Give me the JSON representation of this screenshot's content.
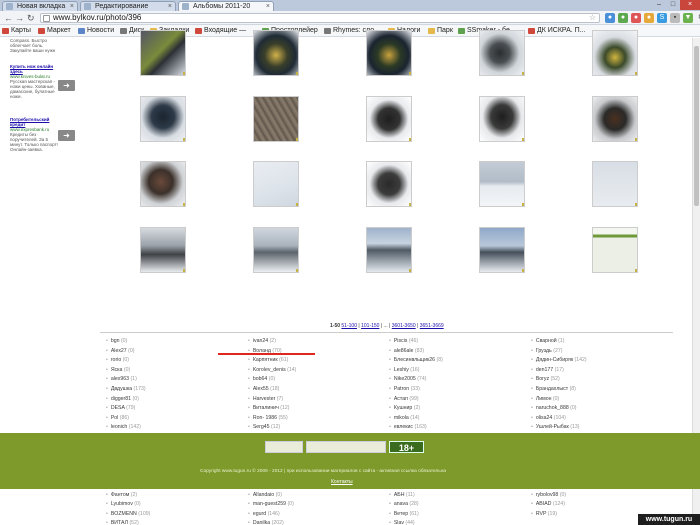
{
  "browser": {
    "tabs": [
      {
        "title": "Новая вкладка",
        "active": false
      },
      {
        "title": "Редактирование",
        "active": false
      },
      {
        "title": "Альбомы 2011-20",
        "active": true
      }
    ],
    "url": "www.bylkov.ru/photo/396",
    "bookmarks": [
      "Карты",
      "Маркет",
      "Новости",
      "Диск",
      "Закладки",
      "Входящие —",
      "Простоплейер",
      "Rhymes: сло...",
      "Налоги",
      "Парк",
      "SSmaker - бе...",
      "ДК ИСКРА. П..."
    ]
  },
  "ads": [
    {
      "text": "Compass. Быстро облегчает боль. Закупайте ваши нужн"
    },
    {
      "link": "Купить нож онлайн здесь",
      "url": "www.knives-bulat.ru",
      "text": "Русская мастерская - ножи цены. Хованые, дамасские, булатные ножи."
    },
    {
      "link": "Потребительский кредит",
      "url": "www.expresbank.ru",
      "text": "Кредиты без поручителей. За 5 минут. Только паспорт! Онлайн-заявка."
    }
  ],
  "pager": {
    "current": "1-50",
    "links": [
      "51-100",
      "101-150",
      "...",
      "3601-3650",
      "3651-3669"
    ]
  },
  "users": [
    [
      {
        "name": "bgn",
        "count": "(0)"
      },
      {
        "name": "Alex27",
        "count": "(0)"
      },
      {
        "name": "rorio",
        "count": "(0)"
      },
      {
        "name": "Яска",
        "count": "(0)"
      },
      {
        "name": "alex963",
        "count": "(1)"
      },
      {
        "name": "Двдушка",
        "count": "(173)"
      },
      {
        "name": "digger81",
        "count": "(0)"
      },
      {
        "name": "DESA",
        "count": "(79)"
      },
      {
        "name": "Pol",
        "count": "(86)"
      },
      {
        "name": "leonich",
        "count": "(142)"
      },
      {
        "name": "Nikolaich",
        "count": "(29)"
      },
      {
        "name": "JordaN",
        "count": "(121)"
      },
      {
        "name": "Alexaindr_65",
        "count": "(71)"
      },
      {
        "name": "БЕЛЫЙ",
        "count": "(9)"
      },
      {
        "name": "banderas",
        "count": "(21)"
      },
      {
        "name": "papazol",
        "count": "(10)"
      },
      {
        "name": "Фантом",
        "count": "(2)"
      },
      {
        "name": "Lyubimov",
        "count": "(0)"
      },
      {
        "name": "BOZMENN",
        "count": "(109)"
      },
      {
        "name": "ВИТАЛ",
        "count": "(52)"
      }
    ],
    [
      {
        "name": "ivan24",
        "count": "(2)"
      },
      {
        "name": "Воланд",
        "count": "(70)"
      },
      {
        "name": "Карпятник",
        "count": "(61)"
      },
      {
        "name": "Korolev_denis",
        "count": "(14)"
      },
      {
        "name": "bob64",
        "count": "(0)"
      },
      {
        "name": "Alex55",
        "count": "(18)"
      },
      {
        "name": "Harvester",
        "count": "(7)"
      },
      {
        "name": "Виталинич",
        "count": "(12)"
      },
      {
        "name": "Ron- 1986",
        "count": "(55)"
      },
      {
        "name": "Serg45",
        "count": "(12)"
      },
      {
        "name": "СеверКом",
        "count": "(13)"
      },
      {
        "name": "ryboed",
        "count": "(29)"
      },
      {
        "name": "Marishka",
        "count": "(9)"
      },
      {
        "name": "Viktor8",
        "count": "(41)"
      },
      {
        "name": "lizer7",
        "count": "(113)"
      },
      {
        "name": "adamtk",
        "count": "(258)"
      },
      {
        "name": "Allandaio",
        "count": "(0)"
      },
      {
        "name": "man-guest259",
        "count": "(0)"
      },
      {
        "name": "egurd",
        "count": "(146)"
      },
      {
        "name": "Danilka",
        "count": "(202)"
      }
    ],
    [
      {
        "name": "Piscis",
        "count": "(46)"
      },
      {
        "name": "ale86ale",
        "count": "(83)"
      },
      {
        "name": "Блесинвльщик26",
        "count": "(8)"
      },
      {
        "name": "Leshiy",
        "count": "(16)"
      },
      {
        "name": "Nike2005",
        "count": "(74)"
      },
      {
        "name": "Patron",
        "count": "(33)"
      },
      {
        "name": "Астап",
        "count": "(99)"
      },
      {
        "name": "Кушнир",
        "count": "(2)"
      },
      {
        "name": "mikola",
        "count": "(14)"
      },
      {
        "name": "евлекис",
        "count": "(163)"
      },
      {
        "name": "Сергеич",
        "count": "(16)"
      },
      {
        "name": "галка-ворона",
        "count": "(8)"
      },
      {
        "name": "zavgar",
        "count": "(19)"
      },
      {
        "name": "Lucker",
        "count": "(15)"
      },
      {
        "name": "щуколов",
        "count": "(0)"
      },
      {
        "name": "Николаич",
        "count": "(39)"
      },
      {
        "name": "АБН",
        "count": "(11)"
      },
      {
        "name": "anava",
        "count": "(28)"
      },
      {
        "name": "Ветер",
        "count": "(61)"
      },
      {
        "name": "Slav",
        "count": "(44)"
      }
    ],
    [
      {
        "name": "Сварной",
        "count": "(1)"
      },
      {
        "name": "Груздь",
        "count": "(27)"
      },
      {
        "name": "Дядин-Сибиряк",
        "count": "(142)"
      },
      {
        "name": "den177",
        "count": "(17)"
      },
      {
        "name": "Boryz",
        "count": "(52)"
      },
      {
        "name": "Брандахлыст",
        "count": "(8)"
      },
      {
        "name": "Лимон",
        "count": "(0)"
      },
      {
        "name": "naruchok_888",
        "count": "(0)"
      },
      {
        "name": "olisa24",
        "count": "(104)"
      },
      {
        "name": "Ушлей-Рыбак",
        "count": "(13)"
      },
      {
        "name": "дичилов",
        "count": "(22)"
      },
      {
        "name": "Kaitabus",
        "count": "(22)"
      },
      {
        "name": "Timychin",
        "count": "(0)"
      },
      {
        "name": "Черкичер",
        "count": "(14)"
      },
      {
        "name": "Леха-рыбак",
        "count": "(51)"
      },
      {
        "name": "ALFER",
        "count": "(27)"
      },
      {
        "name": "rybolov98",
        "count": "(0)"
      },
      {
        "name": "ABIAD",
        "count": "(124)"
      },
      {
        "name": "RVP",
        "count": "(19)"
      }
    ]
  ],
  "footer": {
    "badge": "18+",
    "copyright": "Copyright www.tugun.ru © 2006 - 2012 | при использовании материалов с сайта - активная ссылка обязательна",
    "contacts": "Контакты"
  },
  "watermark": "www.tugun.ru",
  "colors": {
    "footer": "#7d9a2b",
    "accent_red": "#e0261d",
    "link": "#1a0dab"
  }
}
